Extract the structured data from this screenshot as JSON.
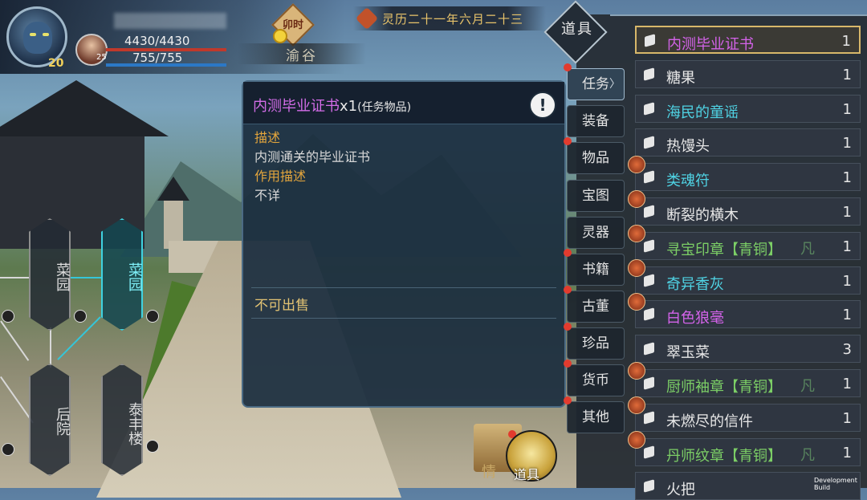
{
  "hud": {
    "level": "20",
    "companion_level": "25",
    "hp": "4430/4430",
    "mp": "755/755",
    "time_of_day": "卯时",
    "location": "渝谷",
    "date": "灵历二十一年六月二十三"
  },
  "map": {
    "nodes": [
      {
        "label": "菜园",
        "active": false
      },
      {
        "label": "菜园",
        "active": true
      },
      {
        "label": "后院",
        "active": false
      },
      {
        "label": "泰丰楼",
        "active": false
      }
    ]
  },
  "bottom": {
    "bag_label": "道具",
    "qing_label": "情"
  },
  "popup": {
    "title": "内测毕业证书",
    "qty": "x1",
    "type": "(任务物品)",
    "info_icon": "!",
    "desc_title": "描述",
    "desc_text": "内测通关的毕业证书",
    "use_title": "作用描述",
    "use_text": "不详",
    "sell_text": "不可出售"
  },
  "inventory": {
    "category_title": "道具",
    "tabs": [
      {
        "label": "任务",
        "active": true
      },
      {
        "label": "装备",
        "active": false
      },
      {
        "label": "物品",
        "active": false
      },
      {
        "label": "宝图",
        "active": false
      },
      {
        "label": "灵器",
        "active": false
      },
      {
        "label": "书籍",
        "active": false
      },
      {
        "label": "古董",
        "active": false
      },
      {
        "label": "珍品",
        "active": false
      },
      {
        "label": "货币",
        "active": false
      },
      {
        "label": "其他",
        "active": false
      }
    ],
    "items": [
      {
        "name": "内测毕业证书",
        "qty": "1",
        "color": "purple",
        "selected": true,
        "badge": false,
        "rank": ""
      },
      {
        "name": "糖果",
        "qty": "1",
        "color": "white",
        "selected": false,
        "badge": false,
        "rank": ""
      },
      {
        "name": "海民的童谣",
        "qty": "1",
        "color": "cyan",
        "selected": false,
        "badge": false,
        "rank": ""
      },
      {
        "name": "热馒头",
        "qty": "1",
        "color": "white",
        "selected": false,
        "badge": false,
        "rank": ""
      },
      {
        "name": "类魂符",
        "qty": "1",
        "color": "cyan",
        "selected": false,
        "badge": true,
        "rank": ""
      },
      {
        "name": "断裂的横木",
        "qty": "1",
        "color": "white",
        "selected": false,
        "badge": true,
        "rank": ""
      },
      {
        "name": "寻宝印章【青铜】",
        "qty": "1",
        "color": "green",
        "selected": false,
        "badge": true,
        "rank": "凡"
      },
      {
        "name": "奇异香灰",
        "qty": "1",
        "color": "cyan",
        "selected": false,
        "badge": true,
        "rank": ""
      },
      {
        "name": "白色狼毫",
        "qty": "1",
        "color": "purple",
        "selected": false,
        "badge": true,
        "rank": ""
      },
      {
        "name": "翠玉菜",
        "qty": "3",
        "color": "white",
        "selected": false,
        "badge": false,
        "rank": ""
      },
      {
        "name": "厨师袖章【青铜】",
        "qty": "1",
        "color": "green",
        "selected": false,
        "badge": true,
        "rank": "凡"
      },
      {
        "name": "未燃尽的信件",
        "qty": "1",
        "color": "white",
        "selected": false,
        "badge": true,
        "rank": ""
      },
      {
        "name": "丹师纹章【青铜】",
        "qty": "1",
        "color": "green",
        "selected": false,
        "badge": true,
        "rank": "凡"
      },
      {
        "name": "火把",
        "qty": "",
        "color": "white",
        "selected": false,
        "badge": false,
        "rank": ""
      }
    ]
  },
  "footer": {
    "dev_build": "Development Build"
  }
}
